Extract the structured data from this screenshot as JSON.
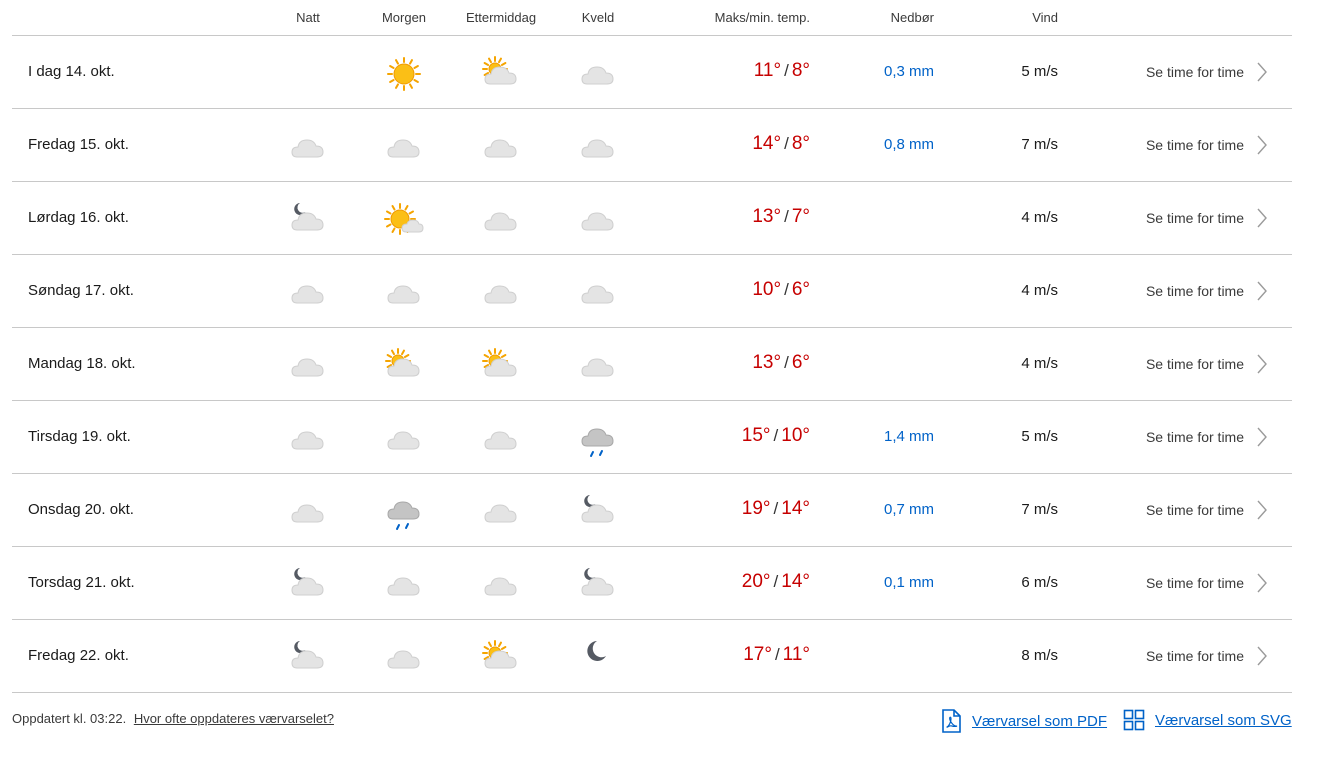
{
  "headers": {
    "natt": "Natt",
    "morgen": "Morgen",
    "ettermiddag": "Ettermiddag",
    "kveld": "Kveld",
    "temp": "Maks/min. temp.",
    "nedbor": "Nedbør",
    "vind": "Vind"
  },
  "rows": [
    {
      "day": "I dag 14. okt.",
      "icons": [
        "",
        "sun",
        "partly-cloudy-day",
        "cloud"
      ],
      "max": "11°",
      "min": "8°",
      "precip": "0,3 mm",
      "wind": "5 m/s",
      "link": "Se time for time"
    },
    {
      "day": "Fredag 15. okt.",
      "icons": [
        "cloud",
        "cloud",
        "cloud",
        "cloud"
      ],
      "max": "14°",
      "min": "8°",
      "precip": "0,8 mm",
      "wind": "7 m/s",
      "link": "Se time for time"
    },
    {
      "day": "Lørdag 16. okt.",
      "icons": [
        "partly-cloudy-night",
        "fair-day",
        "cloud",
        "cloud"
      ],
      "max": "13°",
      "min": "7°",
      "precip": "",
      "wind": "4 m/s",
      "link": "Se time for time"
    },
    {
      "day": "Søndag 17. okt.",
      "icons": [
        "cloud",
        "cloud",
        "cloud",
        "cloud"
      ],
      "max": "10°",
      "min": "6°",
      "precip": "",
      "wind": "4 m/s",
      "link": "Se time for time"
    },
    {
      "day": "Mandag 18. okt.",
      "icons": [
        "cloud",
        "partly-cloudy-day",
        "partly-cloudy-day",
        "cloud"
      ],
      "max": "13°",
      "min": "6°",
      "precip": "",
      "wind": "4 m/s",
      "link": "Se time for time"
    },
    {
      "day": "Tirsdag 19. okt.",
      "icons": [
        "cloud",
        "cloud",
        "cloud",
        "light-rain"
      ],
      "max": "15°",
      "min": "10°",
      "precip": "1,4 mm",
      "wind": "5 m/s",
      "link": "Se time for time"
    },
    {
      "day": "Onsdag 20. okt.",
      "icons": [
        "cloud",
        "light-rain",
        "cloud",
        "partly-cloudy-night"
      ],
      "max": "19°",
      "min": "14°",
      "precip": "0,7 mm",
      "wind": "7 m/s",
      "link": "Se time for time"
    },
    {
      "day": "Torsdag 21. okt.",
      "icons": [
        "partly-cloudy-night",
        "cloud",
        "cloud",
        "partly-cloudy-night"
      ],
      "max": "20°",
      "min": "14°",
      "precip": "0,1 mm",
      "wind": "6 m/s",
      "link": "Se time for time"
    },
    {
      "day": "Fredag 22. okt.",
      "icons": [
        "partly-cloudy-night",
        "cloud",
        "partly-cloudy-day",
        "clear-night"
      ],
      "max": "17°",
      "min": "11°",
      "precip": "",
      "wind": "8 m/s",
      "link": "Se time for time"
    }
  ],
  "footer": {
    "updated": "Oppdatert kl. 03:22.",
    "how_often": "Hvor ofte oppdateres værvarselet?",
    "pdf": "Værvarsel som PDF",
    "svg": "Værvarsel som SVG"
  },
  "colors": {
    "temp": "#c60000",
    "precip": "#0062c8",
    "link": "#0062c8",
    "divider": "#c8c8c8"
  }
}
